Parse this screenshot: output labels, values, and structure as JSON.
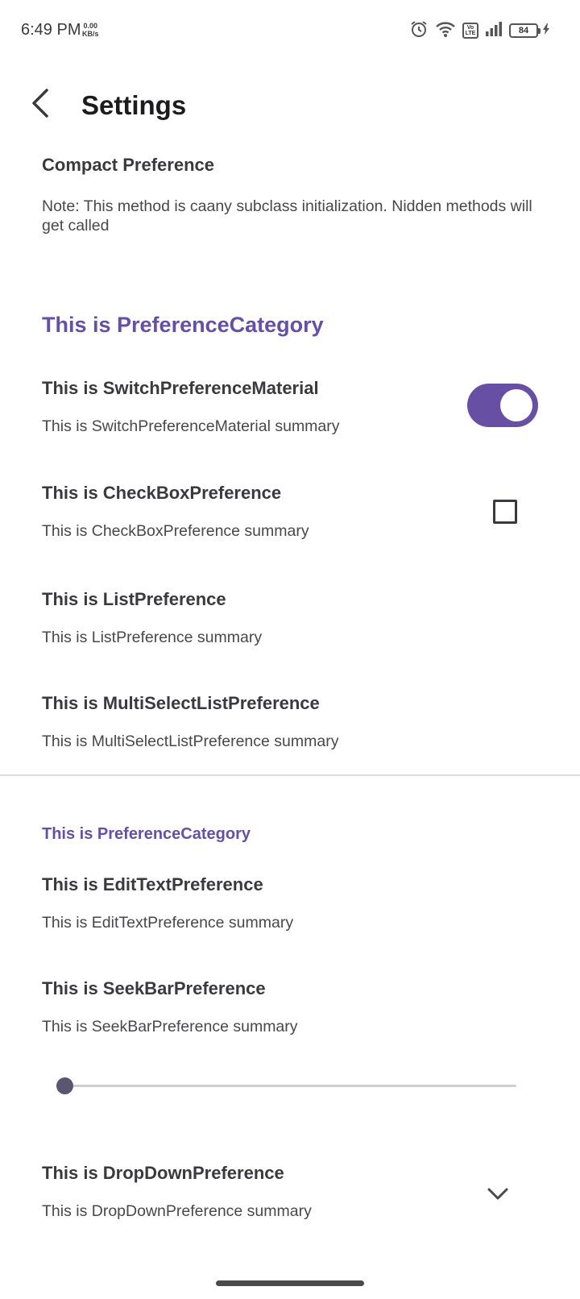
{
  "status_bar": {
    "time": "6:49 PM",
    "speed_value": "0.00",
    "speed_unit": "KB/s",
    "volte_label": "Vo LTE",
    "battery_level": "84",
    "icons": [
      "alarm-icon",
      "wifi-icon",
      "volte-icon",
      "signal-icon",
      "battery-icon",
      "charging-icon"
    ]
  },
  "app_bar": {
    "title": "Settings",
    "back_icon": "chevron-left-icon"
  },
  "compact": {
    "title": "Compact Preference",
    "summary": "Note: This method is caany subclass initialization. Nidden methods will get called"
  },
  "category1": {
    "title": "This is PreferenceCategory",
    "switch_pref": {
      "title": "This is SwitchPreferenceMaterial",
      "summary": "This is SwitchPreferenceMaterial summary",
      "checked": true
    },
    "checkbox_pref": {
      "title": "This is CheckBoxPreference",
      "summary": "This is CheckBoxPreference summary",
      "checked": false
    },
    "list_pref": {
      "title": "This is ListPreference",
      "summary": "This is ListPreference summary"
    },
    "multi_list_pref": {
      "title": "This is MultiSelectListPreference",
      "summary": "This is MultiSelectListPreference summary"
    }
  },
  "category2": {
    "title": "This is PreferenceCategory",
    "edit_text_pref": {
      "title": "This is EditTextPreference",
      "summary": "This is EditTextPreference summary"
    },
    "seekbar_pref": {
      "title": "This is SeekBarPreference",
      "summary": "This is SeekBarPreference summary",
      "value_fraction": 0
    },
    "dropdown_pref": {
      "title": "This is DropDownPreference",
      "summary": "This is DropDownPreference summary",
      "icon": "chevron-down-icon"
    }
  },
  "colors": {
    "accent": "#6750a4",
    "text_primary": "#3a3a3e",
    "text_secondary": "#48484c"
  }
}
